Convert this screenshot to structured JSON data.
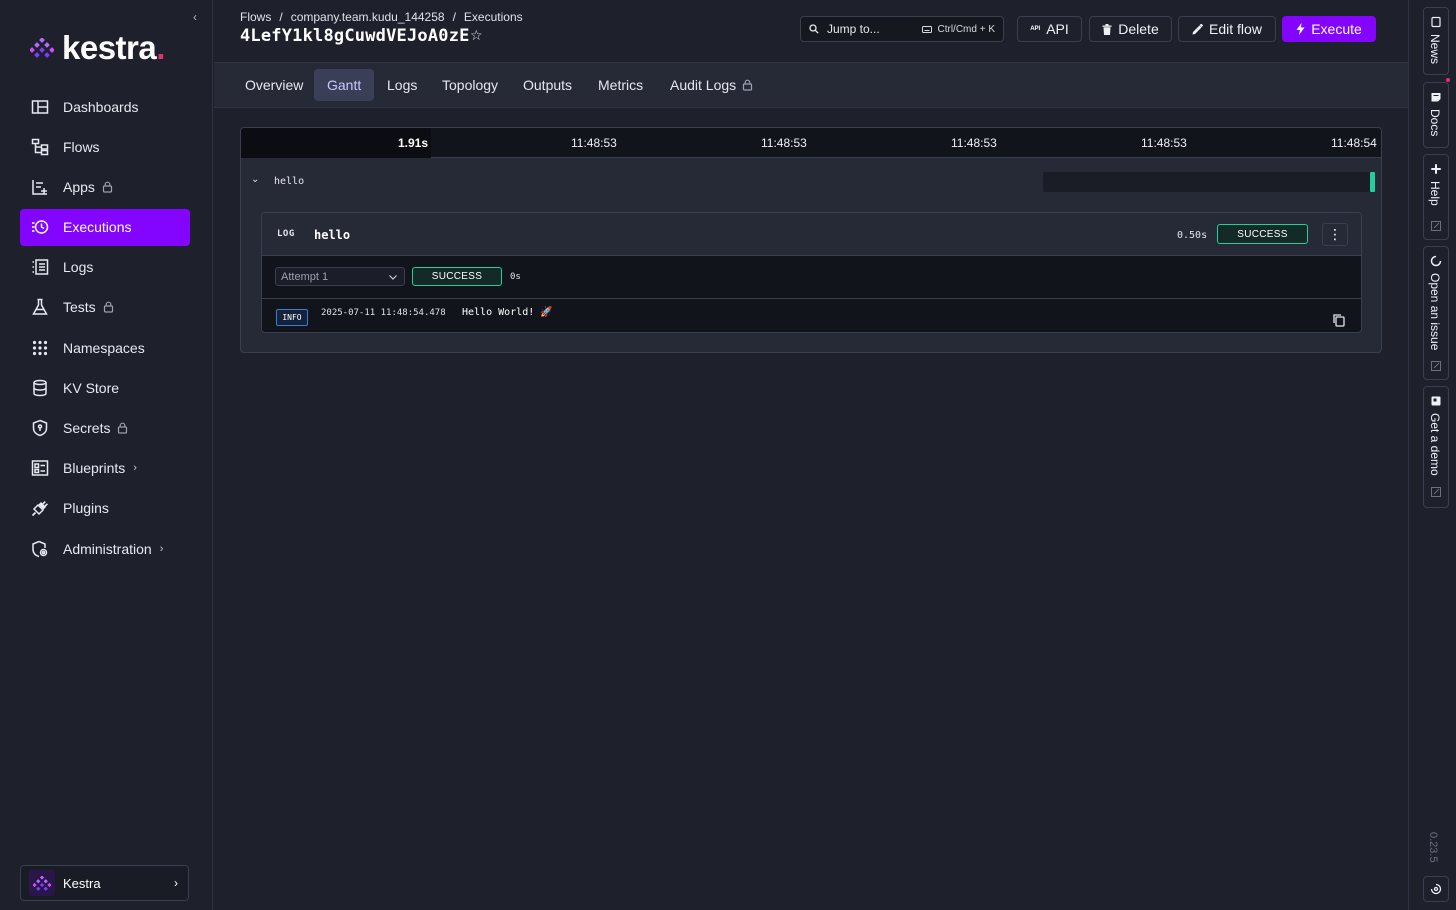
{
  "sidebar": {
    "collapse_glyph": "‹",
    "logo_text": "kestra",
    "logo_dot": ".",
    "items": [
      {
        "label": "Dashboards",
        "icon": "dashboard-icon"
      },
      {
        "label": "Flows",
        "icon": "flows-icon"
      },
      {
        "label": "Apps",
        "icon": "apps-icon",
        "locked": true
      },
      {
        "label": "Executions",
        "icon": "executions-icon",
        "active": true
      },
      {
        "label": "Logs",
        "icon": "logs-icon"
      },
      {
        "label": "Tests",
        "icon": "flask-icon",
        "locked": true
      },
      {
        "label": "Namespaces",
        "icon": "grid-dots-icon"
      },
      {
        "label": "KV Store",
        "icon": "database-icon"
      },
      {
        "label": "Secrets",
        "icon": "shield-lock-icon",
        "locked": true
      },
      {
        "label": "Blueprints",
        "icon": "blueprint-icon",
        "has_submenu": true
      },
      {
        "label": "Plugins",
        "icon": "plug-icon"
      },
      {
        "label": "Administration",
        "icon": "admin-icon",
        "has_submenu": true
      }
    ],
    "tenant": {
      "name": "Kestra",
      "chevron": "›"
    }
  },
  "header": {
    "breadcrumb": [
      "Flows",
      "company.team.kudu_144258",
      "Executions"
    ],
    "breadcrumb_sep": "/",
    "title": "4LefY1kl8gCuwdVEJoA0zE",
    "star": "☆",
    "jump": {
      "label": "Jump to...",
      "shortcut": "Ctrl/Cmd + K"
    },
    "buttons": {
      "api": "API",
      "api_tag": "API",
      "delete": "Delete",
      "edit_flow": "Edit flow",
      "execute": "Execute"
    }
  },
  "tabs": [
    {
      "label": "Overview"
    },
    {
      "label": "Gantt",
      "active": true
    },
    {
      "label": "Logs"
    },
    {
      "label": "Topology"
    },
    {
      "label": "Outputs"
    },
    {
      "label": "Metrics"
    },
    {
      "label": "Audit Logs",
      "locked": true
    }
  ],
  "gantt": {
    "header": [
      "1.91s",
      "11:48:53",
      "11:48:53",
      "11:48:53",
      "11:48:53",
      "11:48:54"
    ],
    "task": {
      "name": "hello",
      "toggle": "⌄"
    },
    "detail": {
      "type_label": "LOG",
      "title": "hello",
      "duration": "0.50s",
      "status": "SUCCESS",
      "kebab": "⋮",
      "attempt": {
        "label": "Attempt 1",
        "status": "SUCCESS",
        "duration": "0s"
      },
      "log": {
        "level": "INFO",
        "timestamp": "2025-07-11 11:48:54.478",
        "message": "Hello World! 🚀"
      }
    }
  },
  "rail": {
    "items": [
      "News",
      "Docs",
      "Help",
      "Open an issue",
      "Get a demo"
    ],
    "version": "0.23.5"
  },
  "colors": {
    "accent": "#8405ff",
    "success": "#21ce9c",
    "brand_dot": "#e0316b"
  }
}
